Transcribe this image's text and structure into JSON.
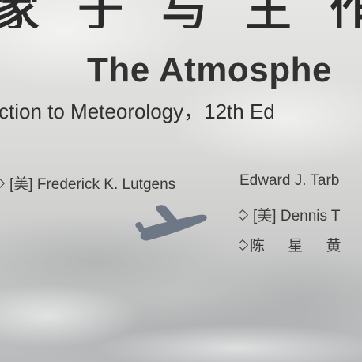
{
  "cover": {
    "title_cn": "家 于 与 王 作",
    "title_en": "The Atmosphe",
    "subtitle": "ction to Meteorology，12th Ed",
    "authors": {
      "first_prefix": "[美]",
      "first_name": "Frederick K. Lutgens",
      "second_name": "Edward J. Tarb",
      "third_prefix": "[美]",
      "third_name": "Dennis T",
      "translators": "陈 星  黄 相"
    }
  },
  "icons": {
    "logo": "airplane-icon"
  },
  "colors": {
    "text": "#333333",
    "plane": "#6d7785",
    "rule": "#6f6f6f"
  }
}
